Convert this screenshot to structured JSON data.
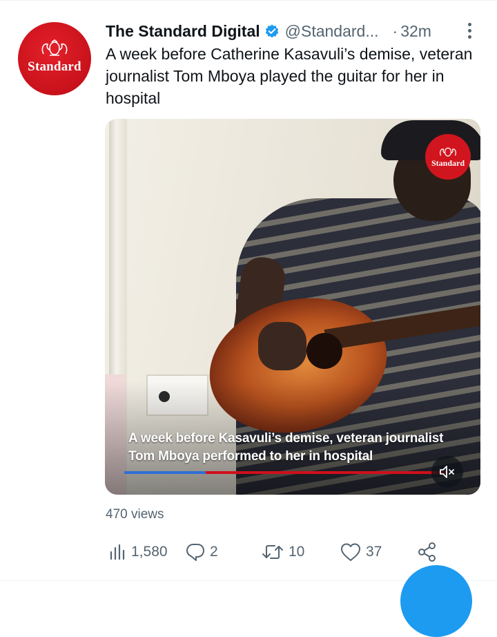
{
  "tweet": {
    "author_name": "The Standard Digital",
    "handle": "@Standard...",
    "separator": "·",
    "time": "32m",
    "text": "A week before Catherine Kasavuli’s demise, veteran journalist Tom Mboya played the guitar for her in hospital",
    "avatar_text": "Standard",
    "verified_color": "#1d9bf0"
  },
  "media": {
    "logo_text": "Standard",
    "caption": "A week before Kasavuli’s demise, veteran journalist Tom Mboya performed to her in hospital",
    "progress": 0.25,
    "mute_icon": "speaker-muted-icon"
  },
  "views": "470 views",
  "actions": {
    "views_count": "1,580",
    "replies": "2",
    "retweets": "10",
    "likes": "37"
  },
  "colors": {
    "brand_red": "#d1151f",
    "accent_blue": "#1d9bf0",
    "muted_text": "#536471"
  }
}
